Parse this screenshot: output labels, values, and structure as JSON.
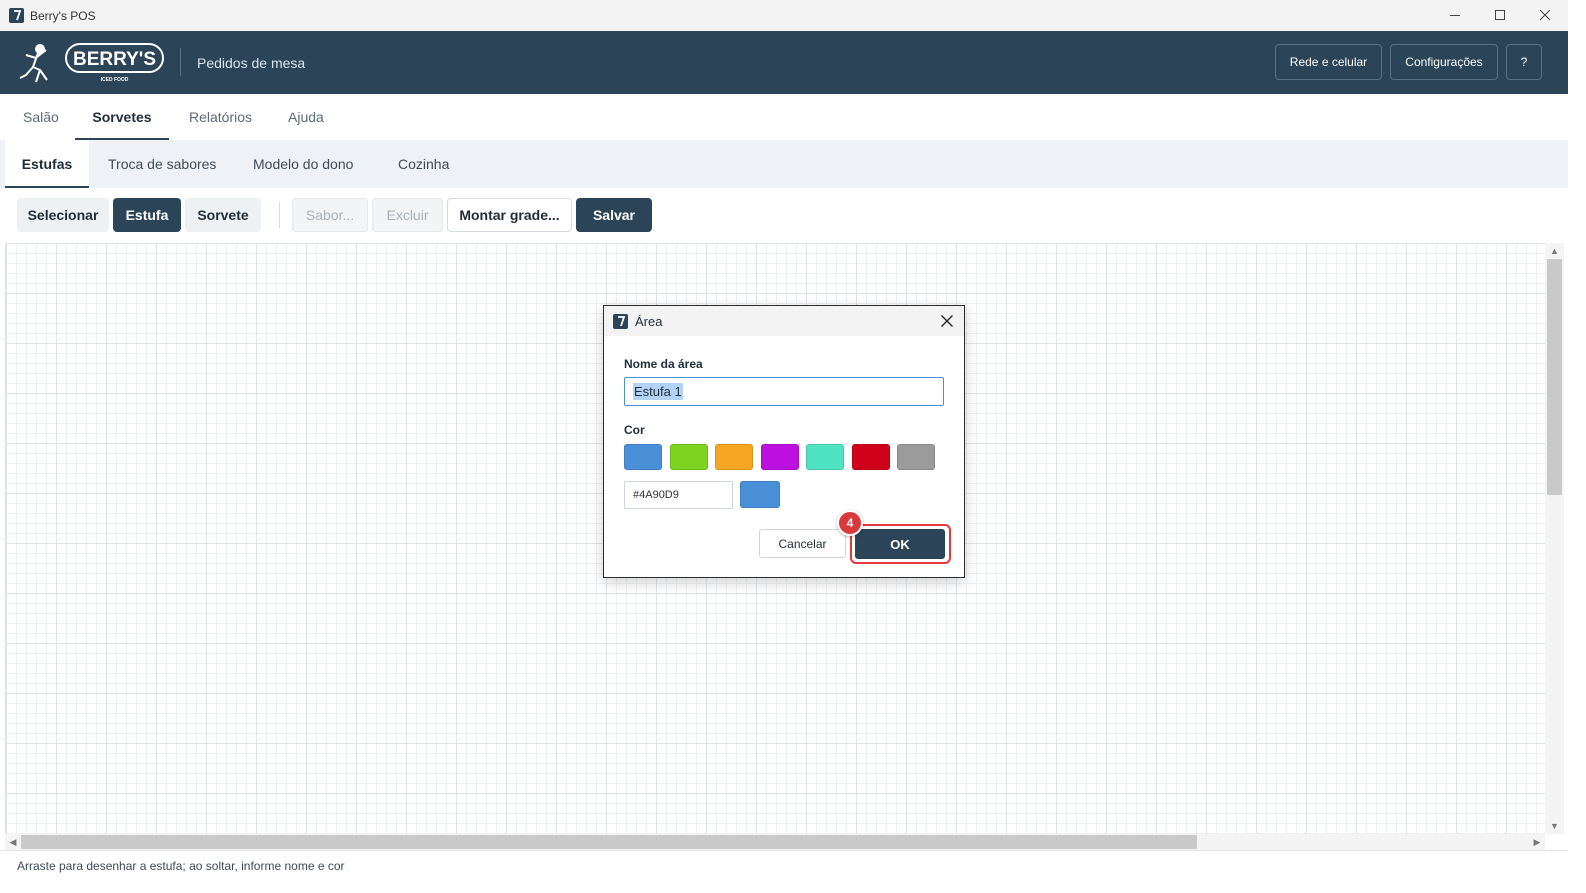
{
  "window": {
    "title": "Berry's POS",
    "icon": "app-icon"
  },
  "header": {
    "logo_text": "BERRY'S",
    "logo_tagline": "ICED FOOD",
    "subtitle": "Pedidos de mesa",
    "buttons": {
      "network": "Rede e celular",
      "settings": "Configurações",
      "help": "?"
    }
  },
  "main_tabs": [
    {
      "label": "Salão",
      "active": false
    },
    {
      "label": "Sorvetes",
      "active": true
    },
    {
      "label": "Relatórios",
      "active": false
    },
    {
      "label": "Ajuda",
      "active": false
    }
  ],
  "sub_tabs": [
    {
      "label": "Estufas",
      "active": true
    },
    {
      "label": "Troca de sabores",
      "active": false
    },
    {
      "label": "Modelo do dono",
      "active": false
    },
    {
      "label": "Cozinha",
      "active": false
    }
  ],
  "toolbar": {
    "select": "Selecionar",
    "estufa": "Estufa",
    "sorvete": "Sorvete",
    "sabor": "Sabor...",
    "excluir": "Excluir",
    "montar": "Montar grade...",
    "salvar": "Salvar"
  },
  "status": {
    "text": "Arraste para desenhar a estufa; ao soltar, informe nome e cor"
  },
  "dialog": {
    "title": "Área",
    "name_label": "Nome da área",
    "name_value": "Estufa 1",
    "color_label": "Cor",
    "swatches": [
      "#4A90D9",
      "#7ED321",
      "#F5A623",
      "#BD10E0",
      "#50E3C2",
      "#D0021B",
      "#9B9B9B"
    ],
    "hex_value": "#4A90D9",
    "preview_color": "#4A90D9",
    "cancel": "Cancelar",
    "ok": "OK",
    "step_badge": "4"
  },
  "colors": {
    "brand": "#2B4457",
    "highlight": "#E0393E"
  }
}
